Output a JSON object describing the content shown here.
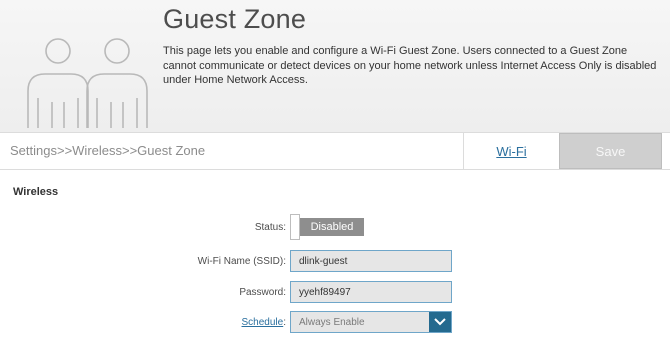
{
  "header": {
    "title": "Guest Zone",
    "description": "This page lets you enable and configure a Wi-Fi Guest Zone. Users connected to a Guest Zone cannot communicate or detect devices on your home network unless Internet Access Only is disabled under Home Network Access.",
    "illustration_icon": "guest-users-icon"
  },
  "nav": {
    "breadcrumb": "Settings>>Wireless>>Guest Zone",
    "wifi_link": "Wi-Fi",
    "save_label": "Save"
  },
  "wireless": {
    "section_title": "Wireless",
    "status_label": "Status:",
    "status_value": "Disabled",
    "ssid_label": "Wi-Fi Name (SSID):",
    "ssid_value": "dlink-guest",
    "password_label": "Password:",
    "password_value": "yyehf89497",
    "schedule_label": "Schedule",
    "schedule_colon": ":",
    "schedule_value": "Always Enable",
    "schedule_arrow_icon": "chevron-down-icon"
  },
  "colors": {
    "accent": "#246a8f",
    "link": "#2a6f9e",
    "toggle_off": "#8e8e8e",
    "save_disabled": "#cfcfcf"
  }
}
